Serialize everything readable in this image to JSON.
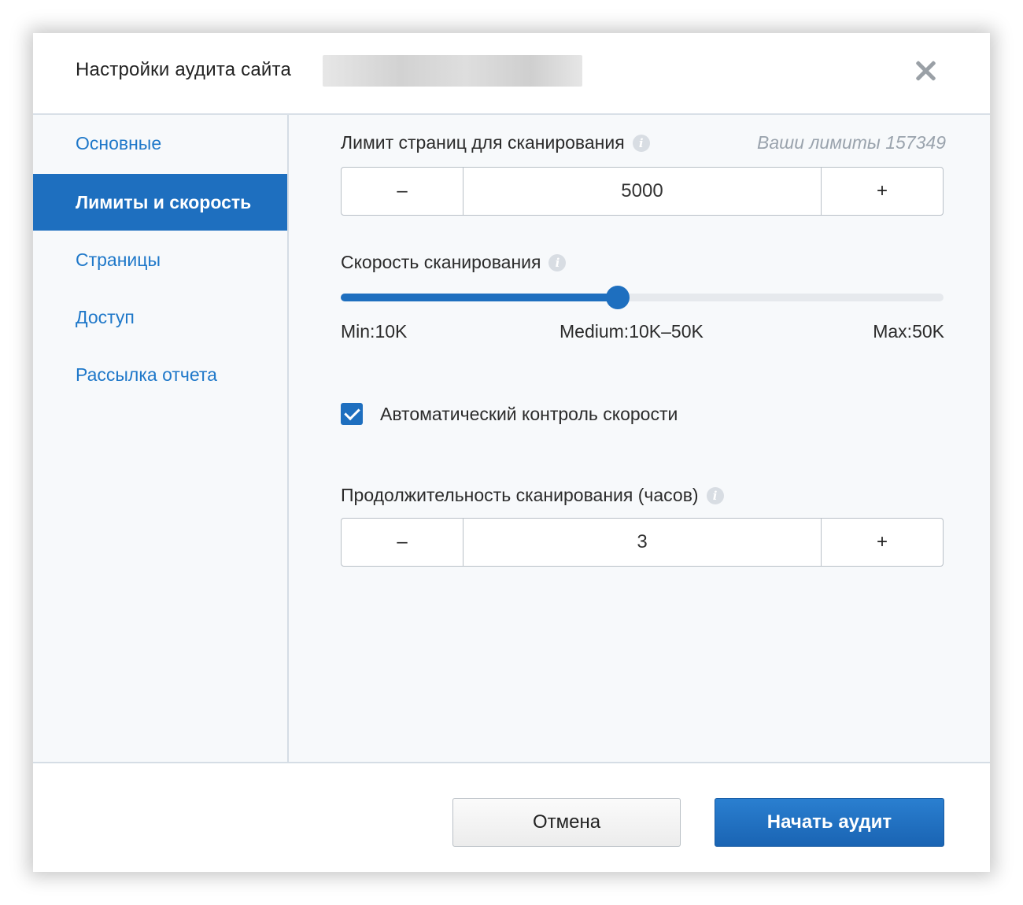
{
  "dialog": {
    "title": "Настройки аудита сайта",
    "close_icon": "close-icon"
  },
  "sidebar": {
    "items": [
      {
        "label": "Основные",
        "active": false
      },
      {
        "label": "Лимиты и скорость",
        "active": true
      },
      {
        "label": "Страницы",
        "active": false
      },
      {
        "label": "Доступ",
        "active": false
      },
      {
        "label": "Рассылка отчета",
        "active": false
      }
    ]
  },
  "page_limit": {
    "label": "Лимит страниц для сканирования",
    "info_icon": "info-icon",
    "limits_note": "Ваши лимиты 157349",
    "minus": "–",
    "value": "5000",
    "plus": "+"
  },
  "speed": {
    "label": "Скорость сканирования",
    "info_icon": "info-icon",
    "level": 0.46,
    "min_label": "Min:10K",
    "medium_label": "Medium:10K–50K",
    "max_label": "Max:50K"
  },
  "auto_speed": {
    "checked": true,
    "label": "Автоматический контроль скорости"
  },
  "duration": {
    "label": "Продолжительность сканирования (часов)",
    "info_icon": "info-icon",
    "minus": "–",
    "value": "3",
    "plus": "+"
  },
  "footer": {
    "cancel_label": "Отмена",
    "start_label": "Начать аудит"
  },
  "colors": {
    "accent": "#1e6fbf",
    "link": "#1f78c9"
  }
}
